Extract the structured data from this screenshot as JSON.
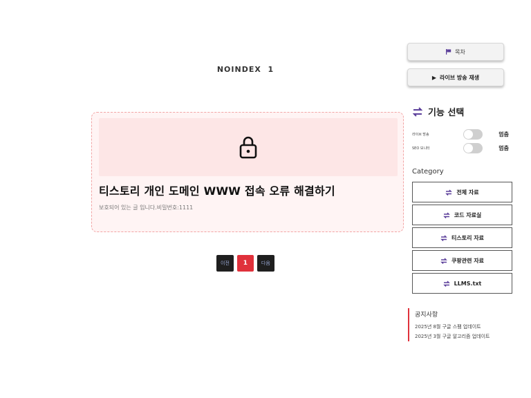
{
  "header": {
    "noindex_text": "NOINDEX  1"
  },
  "post": {
    "title": "티스토리 개인 도메인 WWW 접속 오류 해결하기",
    "description": "보호되어 있는 글 입니다.비밀번호:1111",
    "lock_icon": "lock-icon"
  },
  "pagination": {
    "prev_label": "이전",
    "current_page": "1",
    "next_label": "다음"
  },
  "sidebar": {
    "toc_label": "목차",
    "live_label": "라이브 방송 재생",
    "feature_title": "기능 선택",
    "toggles": [
      {
        "label": "라이브 방송",
        "state": "멈춤"
      },
      {
        "label": "SEO 모니터",
        "state": "멈춤"
      }
    ],
    "category_title": "Category",
    "categories": [
      {
        "label": "전체 자료"
      },
      {
        "label": "코드 자료실"
      },
      {
        "label": "티스토리 자료"
      },
      {
        "label": "쿠팡관련 자료"
      },
      {
        "label": "LLMS.txt"
      }
    ],
    "notice_title": "공지사항",
    "notices": [
      "2025년 8월 구글 스팸 업데이트",
      "2025년 3월 구글 알고리즘 업데이트"
    ]
  },
  "colors": {
    "accent": "#e0313b",
    "icon_purple": "#5b3f9a",
    "card_bg": "#fff4f4"
  }
}
